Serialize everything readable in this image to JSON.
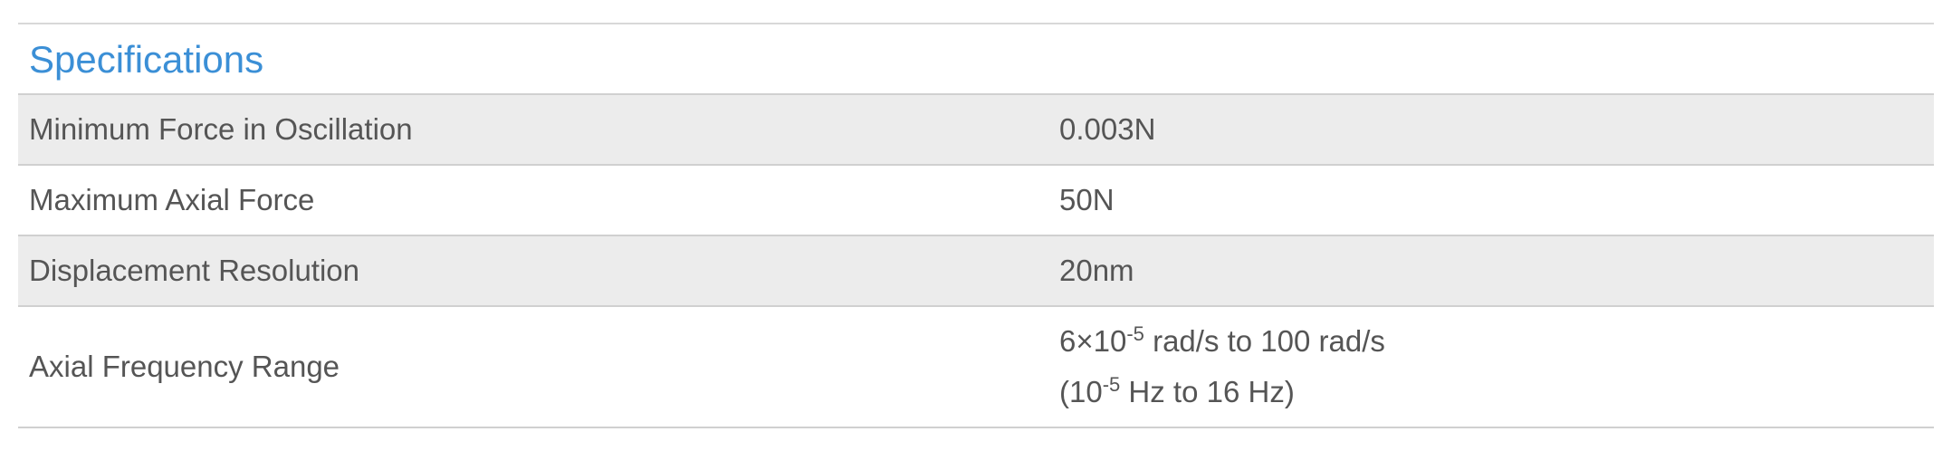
{
  "section": {
    "title": "Specifications"
  },
  "rows": [
    {
      "label": "Minimum Force in Oscillation",
      "value": "0.003N"
    },
    {
      "label": "Maximum Axial Force",
      "value": "50N"
    },
    {
      "label": "Displacement Resolution",
      "value": "20nm"
    },
    {
      "label": "Axial Frequency Range",
      "value_line1_base": "6×10",
      "value_line1_exp": "-5",
      "value_line1_rest": " rad/s to 100 rad/s",
      "value_line2_base": "(10",
      "value_line2_exp": "-5",
      "value_line2_rest": " Hz to 16 Hz)"
    }
  ],
  "colors": {
    "title": "#3b8fd6",
    "text": "#555555",
    "shaded_row": "#ececec",
    "divider": "#d0d0d0"
  }
}
